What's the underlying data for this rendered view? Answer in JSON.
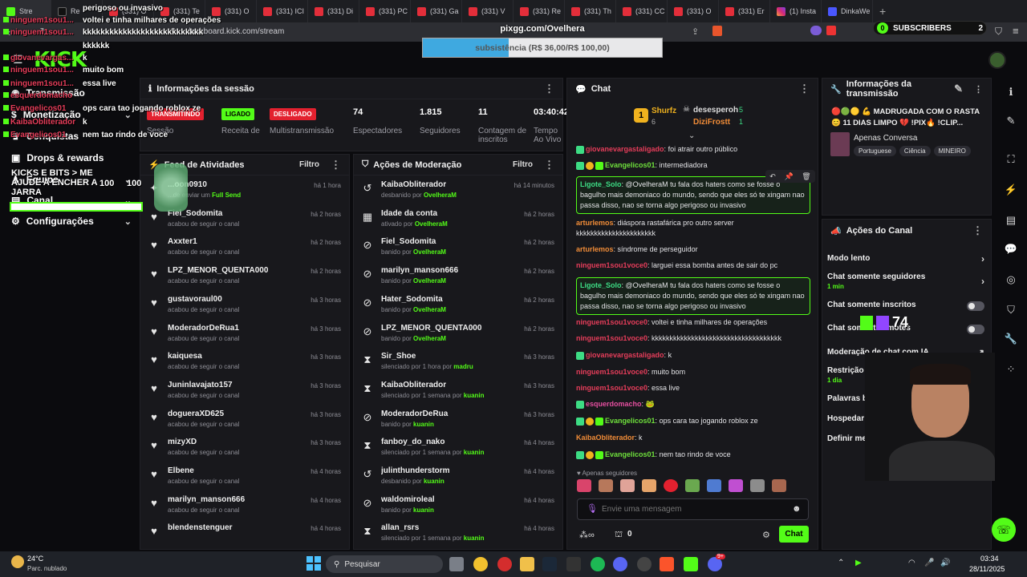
{
  "browser": {
    "tabs": [
      {
        "label": "Stre",
        "icon": "kick"
      },
      {
        "label": "Re",
        "icon": "tiktok"
      },
      {
        "label": "(331) O",
        "icon": "yt"
      },
      {
        "label": "(331) Te",
        "icon": "yt"
      },
      {
        "label": "(331) O",
        "icon": "yt"
      },
      {
        "label": "(331) ICI",
        "icon": "yt"
      },
      {
        "label": "(331) Di",
        "icon": "yt"
      },
      {
        "label": "(331) PC",
        "icon": "yt"
      },
      {
        "label": "(331) Ga",
        "icon": "yt"
      },
      {
        "label": "(331) V",
        "icon": "yt"
      },
      {
        "label": "(331) Re",
        "icon": "yt"
      },
      {
        "label": "(331) Th",
        "icon": "yt"
      },
      {
        "label": "(331) CC",
        "icon": "yt"
      },
      {
        "label": "(331) O",
        "icon": "yt"
      },
      {
        "label": "(331) Er",
        "icon": "yt"
      },
      {
        "label": "(1) Insta",
        "icon": "ig"
      },
      {
        "label": "DinkaWe",
        "icon": "dk"
      }
    ],
    "url": "dashboard.kick.com/stream",
    "new_tab": "+"
  },
  "overlay": {
    "goal_title": "pixgg.com/Ovelhera",
    "goal_text": "subsistência (R$ 36,00/R$ 100,00)",
    "goal_progress": 0.36,
    "subs_label": "SUBSCRIBERS",
    "subs_count": "2",
    "subs_left": "0",
    "kicks_title": "KICKS E BITS > ME AJUDE A ENCHER A JARRA",
    "kicks_count": "100",
    "kicks_total": "100",
    "viewer_count": "74",
    "chat": [
      {
        "user": "",
        "msg": "perigoso ou invasivo"
      },
      {
        "user": "ninguem1sou1...",
        "msg": "voltei e tinha milhares de operações"
      },
      {
        "user": "ninguem1sou1...",
        "msg": "kkkkkkkkkkkkkkkkkkkkkkkkkkk"
      },
      {
        "user": "",
        "msg": "kkkkkk"
      },
      {
        "user": "giovanevargas...",
        "msg": "k"
      },
      {
        "user": "ninguem1sou1...",
        "msg": "muito bom"
      },
      {
        "user": "ninguem1sou1...",
        "msg": "essa live"
      },
      {
        "user": "esquerdomacho",
        "msg": ""
      },
      {
        "user": "Evangelicos01",
        "msg": "ops cara tao jogando roblox ze"
      },
      {
        "user": "KaibaObliterador",
        "msg": "k"
      },
      {
        "user": "Evangelicos01",
        "msg": "nem tao rindo de voce"
      }
    ]
  },
  "sidebar": {
    "items": [
      {
        "label": "Transmissão",
        "chev": ""
      },
      {
        "label": "Monetização",
        "chev": "⌄"
      },
      {
        "label": "Conquistas",
        "chev": ""
      },
      {
        "label": "Drops & rewards",
        "chev": ""
      },
      {
        "label": "Equipe",
        "chev": "⌄"
      },
      {
        "label": "Canal",
        "chev": "⌄"
      },
      {
        "label": "Configurações",
        "chev": "⌄"
      }
    ]
  },
  "session": {
    "title": "Informações da sessão",
    "badges": [
      {
        "label": "TRANSMITINDO",
        "caption": "Sessão",
        "color": "#e3212f"
      },
      {
        "label": "LIGADO",
        "caption": "Receita de",
        "color": "#53fc18"
      },
      {
        "label": "DESLIGADO",
        "caption": "Multistransmissão",
        "color": "#e3212f"
      }
    ],
    "stats": [
      {
        "value": "74",
        "label": "Espectadores"
      },
      {
        "value": "1.815",
        "label": "Seguidores"
      },
      {
        "value": "11",
        "label": "Contagem de inscritos"
      },
      {
        "value": "03:40:42",
        "label": "Tempo Ao Vivo"
      }
    ]
  },
  "feed": {
    "title": "Feed de Atividades",
    "filter": "Filtro",
    "items": [
      {
        "name": "...oon0910",
        "sub": "...de enviar um",
        "sub_b": "Full Send",
        "time": "há 1 hora"
      },
      {
        "name": "Fiel_Sodomita",
        "sub": "acabou de seguir o canal",
        "sub_b": "",
        "time": "há 2 horas"
      },
      {
        "name": "Axxter1",
        "sub": "acabou de seguir o canal",
        "sub_b": "",
        "time": "há 2 horas"
      },
      {
        "name": "LPZ_MENOR_QUENTA000",
        "sub": "acabou de seguir o canal",
        "sub_b": "",
        "time": "há 2 horas"
      },
      {
        "name": "gustavoraul00",
        "sub": "acabou de seguir o canal",
        "sub_b": "",
        "time": "há 3 horas"
      },
      {
        "name": "ModeradorDeRua1",
        "sub": "acabou de seguir o canal",
        "sub_b": "",
        "time": "há 3 horas"
      },
      {
        "name": "kaiquesa",
        "sub": "acabou de seguir o canal",
        "sub_b": "",
        "time": "há 3 horas"
      },
      {
        "name": "Juninlavajato157",
        "sub": "acabou de seguir o canal",
        "sub_b": "",
        "time": "há 3 horas"
      },
      {
        "name": "dogueraXD625",
        "sub": "acabou de seguir o canal",
        "sub_b": "",
        "time": "há 3 horas"
      },
      {
        "name": "mizyXD",
        "sub": "acabou de seguir o canal",
        "sub_b": "",
        "time": "há 3 horas"
      },
      {
        "name": "Elbene",
        "sub": "acabou de seguir o canal",
        "sub_b": "",
        "time": "há 4 horas"
      },
      {
        "name": "marilyn_manson666",
        "sub": "acabou de seguir o canal",
        "sub_b": "",
        "time": "há 4 horas"
      },
      {
        "name": "blendenstenguer",
        "sub": "",
        "sub_b": "",
        "time": "há 4 horas"
      }
    ]
  },
  "moderation": {
    "title": "Ações de Moderação",
    "filter": "Filtro",
    "items": [
      {
        "icon": "unban",
        "name": "KaibaObliterador",
        "sub": "desbanido por",
        "by": "OvelheraM",
        "time": "há 14 minutos"
      },
      {
        "icon": "calendar",
        "name": "Idade da conta",
        "sub": "ativado por",
        "by": "OvelheraM",
        "time": "há 2 horas"
      },
      {
        "icon": "ban",
        "name": "Fiel_Sodomita",
        "sub": "banido por",
        "by": "OvelheraM",
        "time": "há 2 horas"
      },
      {
        "icon": "ban",
        "name": "marilyn_manson666",
        "sub": "banido por",
        "by": "OvelheraM",
        "time": "há 2 horas"
      },
      {
        "icon": "ban",
        "name": "Hater_Sodomita",
        "sub": "banido por",
        "by": "OvelheraM",
        "time": "há 2 horas"
      },
      {
        "icon": "ban",
        "name": "LPZ_MENOR_QUENTA000",
        "sub": "banido por",
        "by": "OvelheraM",
        "time": "há 2 horas"
      },
      {
        "icon": "timer",
        "name": "Sir_Shoe",
        "sub": "silenciado por 1 hora por",
        "by": "madru",
        "time": "há 3 horas"
      },
      {
        "icon": "timer",
        "name": "KaibaObliterador",
        "sub": "silenciado por 1 semana por",
        "by": "kuanin",
        "time": "há 3 horas"
      },
      {
        "icon": "ban",
        "name": "ModeradorDeRua",
        "sub": "banido por",
        "by": "kuanin",
        "time": "há 3 horas"
      },
      {
        "icon": "timer",
        "name": "fanboy_do_nako",
        "sub": "silenciado por 1 semana por",
        "by": "kuanin",
        "time": "há 4 horas"
      },
      {
        "icon": "unban",
        "name": "julinthunderstorm",
        "sub": "desbanido por",
        "by": "kuanin",
        "time": "há 4 horas"
      },
      {
        "icon": "ban",
        "name": "waldomiroleal",
        "sub": "banido por",
        "by": "kuanin",
        "time": "há 4 horas"
      },
      {
        "icon": "timer",
        "name": "allan_rsrs",
        "sub": "silenciado por 1 semana por",
        "by": "kuanin",
        "time": "há 4 horas"
      }
    ]
  },
  "chat": {
    "title": "Chat",
    "leaderboard": [
      {
        "rank": "1",
        "user": "Shurfz",
        "count": "6"
      },
      {
        "rank": "",
        "user": "desesperoh",
        "count": "5"
      },
      {
        "rank": "",
        "user": "DiziFrostt",
        "count": "1"
      }
    ],
    "messages": [
      {
        "user": "giovanevargastaligado",
        "msg": "foi atrair outro público",
        "color": "u-red",
        "hl": false
      },
      {
        "user": "Evangelicos01",
        "msg": "intermediadora",
        "color": "u-lime",
        "hl": false
      },
      {
        "user": "Ligote_Solo",
        "msg": "@OvelheraM tu fala dos haters como se fosse o bagulho mais demoniaco do mundo, sendo que eles só te xingam nao passa disso, nao se torna algo perigoso ou invasivo",
        "color": "u-green",
        "hl": true
      },
      {
        "user": "arturlemos",
        "msg": "diáspora rastafárica pro outro server kkkkkkkkkkkkkkkkkkkkkk",
        "color": "u-orange",
        "hl": false
      },
      {
        "user": "arturlemos",
        "msg": "síndrome de perseguidor",
        "color": "u-orange",
        "hl": false
      },
      {
        "user": "ninguem1sou1voce0",
        "msg": "larguei essa bomba antes de sair do pc",
        "color": "u-red",
        "hl": false
      },
      {
        "user": "Ligote_Solo",
        "msg": "@OvelheraM tu fala dos haters como se fosse o bagulho mais demoniaco do mundo, sendo que eles só te xingam nao passa disso, nao se torna algo perigoso ou invasivo",
        "color": "u-green",
        "hl": true
      },
      {
        "user": "ninguem1sou1voce0",
        "msg": "voltei e tinha milhares de operações",
        "color": "u-red",
        "hl": false
      },
      {
        "user": "ninguem1sou1voce0",
        "msg": "kkkkkkkkkkkkkkkkkkkkkkkkkkkkkkkkkkkk",
        "color": "u-red",
        "hl": false
      },
      {
        "user": "giovanevargastaligado",
        "msg": "k",
        "color": "u-red",
        "hl": false
      },
      {
        "user": "ninguem1sou1voce0",
        "msg": "muito bom",
        "color": "u-red",
        "hl": false
      },
      {
        "user": "ninguem1sou1voce0",
        "msg": "essa live",
        "color": "u-red",
        "hl": false
      },
      {
        "user": "esquerdomacho",
        "msg": "🐸",
        "color": "u-pink",
        "hl": false
      },
      {
        "user": "Evangelicos01",
        "msg": "ops cara tao jogando roblox ze",
        "color": "u-lime",
        "hl": false
      },
      {
        "user": "KaibaObliterador",
        "msg": "k",
        "color": "u-orange",
        "hl": false
      },
      {
        "user": "Evangelicos01",
        "msg": "nem tao rindo de voce",
        "color": "u-lime",
        "hl": false
      }
    ],
    "followers_only": "Apenas seguidores",
    "input_placeholder": "Envie uma mensagem",
    "points": "0",
    "send_label": "Chat"
  },
  "stream_info": {
    "title": "Informações da transmissão",
    "stream_title": "🔴🟢🟡 💪 MADRUGADA COM O RASTA 😊 11 DIAS LIMPO 💔 !PIX🔥 !CLIP...",
    "category": "Apenas Conversa",
    "tags": [
      "Portuguese",
      "Ciência",
      "MINEIRO"
    ]
  },
  "channel_actions": {
    "title": "Ações do Canal",
    "items": [
      {
        "label": "Modo lento",
        "sub": "",
        "control": "arrow"
      },
      {
        "label": "Chat somente seguidores",
        "sub": "1 min",
        "control": "arrow"
      },
      {
        "label": "Chat somente inscritos",
        "sub": "",
        "control": "toggle"
      },
      {
        "label": "Chat somente emotes",
        "sub": "",
        "control": "toggle"
      },
      {
        "label": "Moderação de chat com IA",
        "sub": "",
        "control": "external"
      },
      {
        "label": "Restrição de idade",
        "sub": "1 dia",
        "control": "arrow"
      },
      {
        "label": "Palavras banidas",
        "sub": "",
        "control": "none"
      },
      {
        "label": "Hospedar Canal",
        "sub": "",
        "control": "none"
      },
      {
        "label": "Definir metas",
        "sub": "",
        "control": "none"
      }
    ]
  },
  "taskbar": {
    "temp": "24°C",
    "weather": "Parc. nublado",
    "search": "Pesquisar",
    "time": "03:34",
    "date": "28/11/2025",
    "discord_badge": "9+"
  },
  "colors": {
    "accent": "#53fc18",
    "live": "#e3212f",
    "panel": "#18181c"
  }
}
